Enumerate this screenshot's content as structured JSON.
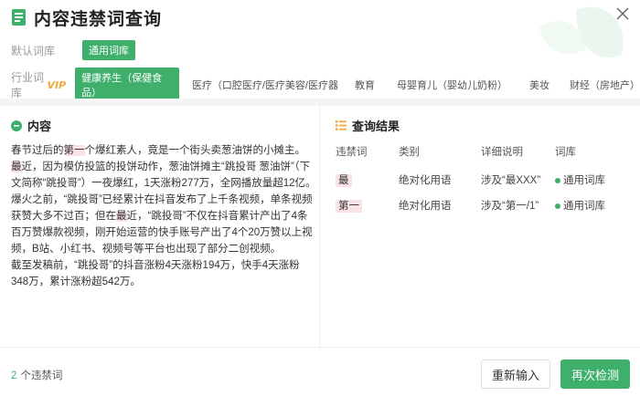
{
  "header": {
    "title": "内容违禁词查询"
  },
  "filters": {
    "default_label": "默认词库",
    "default_chip": "通用词库",
    "industry_label": "行业词库",
    "vip_badge": "VIP",
    "industry_selected": "健康养生（保健食品）",
    "industry_options": [
      "医疗（口腔医疗/医疗美容/医疗器",
      "教育",
      "母婴育儿（婴幼儿奶粉）",
      "美妆",
      "财经（房地产）"
    ]
  },
  "content_panel": {
    "title": "内容",
    "lines": [
      {
        "before": "春节过后的",
        "hl": "第一",
        "after": "个爆红素人，竟是一个街头卖葱油饼的小摊主。"
      },
      {
        "before": "",
        "hl": "最",
        "after": "近，因为模仿投篮的投饼动作，葱油饼摊主“跳投哥 葱油饼”（下文简称“跳投哥”）一夜爆红，1天涨粉277万，全网播放量超12亿。"
      },
      {
        "before": "爆火之前，“跳投哥”已经累计在抖音发布了上千条视频，单条视频获赞大多不过百；但在",
        "hl": "最",
        "after": "近，“跳投哥”不仅在抖音累计产出了4条百万赞爆款视频，刚开始运营的快手账号产出了4个20万赞以上视频，B站、小红书、视频号等平台也出现了部分二创视频。"
      },
      {
        "before": "截至发稿前，“跳投哥”的抖音涨粉4天涨粉194万，快手4天涨粉348万，累计涨粉超542万。",
        "hl": "",
        "after": ""
      }
    ]
  },
  "results_panel": {
    "title": "查询结果",
    "columns": [
      "违禁词",
      "类别",
      "详细说明",
      "词库"
    ],
    "rows": [
      {
        "word": "最",
        "category": "绝对化用语",
        "detail": "涉及“最XXX”",
        "library": "通用词库"
      },
      {
        "word": "第一",
        "category": "绝对化用语",
        "detail": "涉及“第一/1”",
        "library": "通用词库"
      }
    ]
  },
  "footer": {
    "count": "2",
    "count_label": "个违禁词",
    "reset_button": "重新输入",
    "recheck_button": "再次检测"
  },
  "colors": {
    "accent": "#3fb06c",
    "highlight": "#fbe2e6",
    "vip": "#f2a93b"
  }
}
